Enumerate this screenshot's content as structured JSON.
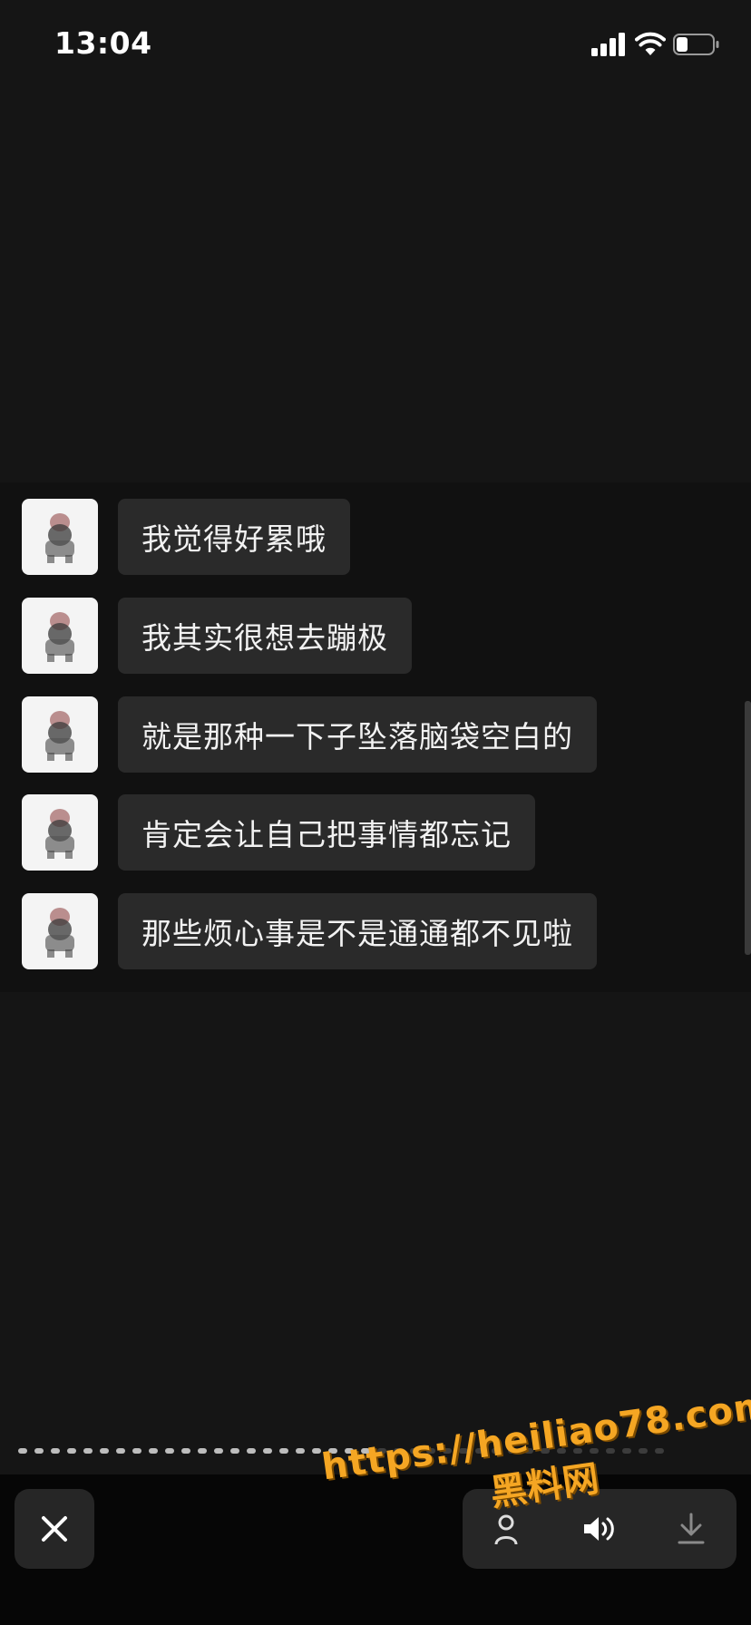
{
  "status_bar": {
    "time": "13:04",
    "signal_icon": "cellular-signal-icon",
    "wifi_icon": "wifi-icon",
    "battery_icon": "battery-icon"
  },
  "chat": {
    "messages": [
      {
        "text": "我觉得好累哦"
      },
      {
        "text": "我其实很想去蹦极"
      },
      {
        "text": "就是那种一下子坠落脑袋空白的"
      },
      {
        "text": "肯定会让自己把事情都忘记"
      },
      {
        "text": "那些烦心事是不是通通都不见啦"
      }
    ]
  },
  "progress": {
    "total_segments": 40,
    "completed_segments": 22
  },
  "toolbar": {
    "close_icon": "close-icon",
    "share_icon": "share-icon",
    "volume_icon": "volume-icon",
    "download_icon": "download-icon"
  },
  "watermark": {
    "url": "https://heiliao78.com",
    "name": "黑料网"
  },
  "colors": {
    "background": "#151515",
    "chat_panel": "#111111",
    "bubble": "#2a2a2a",
    "watermark": "#f5a623"
  }
}
